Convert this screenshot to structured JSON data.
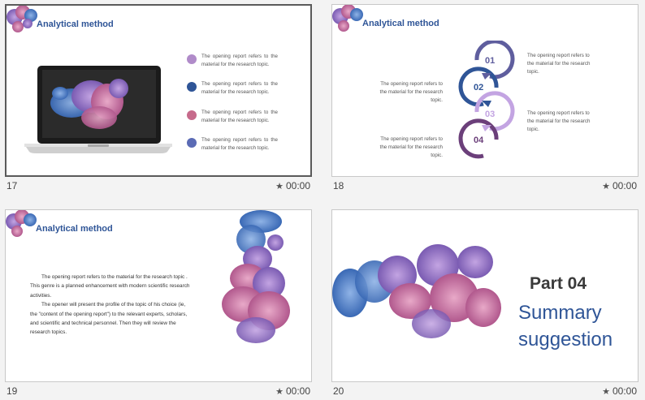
{
  "colors": {
    "title_blue": "#2f5597",
    "lavender": "#b08bc9",
    "navy": "#2f5597",
    "rose": "#c66a8b",
    "slate_blue": "#5b6bb5",
    "purple_dark": "#6b3f7a",
    "purple_mid": "#5f5e9e"
  },
  "slides": [
    {
      "number": "17",
      "time": "00:00",
      "title": "Analytical method",
      "bullets": [
        {
          "text": "The opening report refers to the material for the research topic.",
          "color": "#b08bc9"
        },
        {
          "text": "The opening report refers to the material for the research topic.",
          "color": "#2f5597"
        },
        {
          "text": "The opening report refers to the material for the research topic.",
          "color": "#c66a8b"
        },
        {
          "text": "The opening report refers to the material for the research topic.",
          "color": "#5b6bb5"
        }
      ]
    },
    {
      "number": "18",
      "time": "00:00",
      "title": "Analytical method",
      "steps": [
        "01",
        "02",
        "03",
        "04"
      ],
      "texts": {
        "right_top": "The opening report refers to the material for the research topic.",
        "left_mid": "The opening report refers to the material for the research topic.",
        "right_mid": "The opening report refers to the material for the research topic.",
        "left_bottom": "The opening report refers to the material for the research topic."
      }
    },
    {
      "number": "19",
      "time": "00:00",
      "title": "Analytical method",
      "paragraph1": "The opening report refers to the material for the research topic . This genre is a planned enhancement with modern scientific research activities.",
      "paragraph2": "The opener will present the profile of the topic of his choice (ie, the \"content of the opening report\") to the relevant experts, scholars, and scientific and technical personnel. Then they will review the research topics."
    },
    {
      "number": "20",
      "time": "00:00",
      "part": "Part 04",
      "heading_line1": "Summary",
      "heading_line2": "suggestion"
    }
  ]
}
